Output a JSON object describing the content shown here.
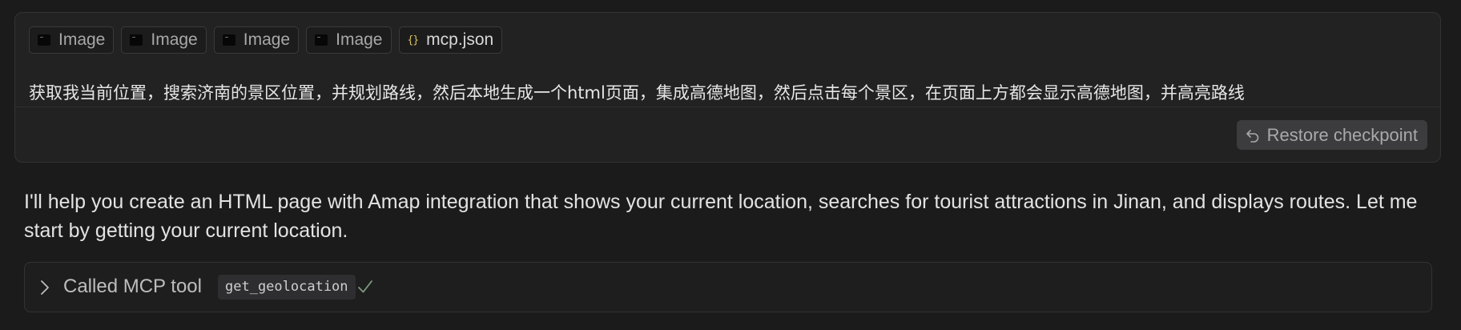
{
  "user_message": {
    "attachments": [
      {
        "label": "Image",
        "icon": "image-thumbnail-icon"
      },
      {
        "label": "Image",
        "icon": "image-thumbnail-icon"
      },
      {
        "label": "Image",
        "icon": "image-thumbnail-icon"
      },
      {
        "label": "Image",
        "icon": "image-thumbnail-icon"
      },
      {
        "label": "mcp.json",
        "icon": "json-braces-icon",
        "icon_glyph": "{}"
      }
    ],
    "text": "获取我当前位置，搜索济南的景区位置，并规划路线，然后本地生成一个html页面，集成高德地图，然后点击每个景区，在页面上方都会显示高德地图，并高亮路线",
    "restore_label": "Restore checkpoint"
  },
  "assistant_message": {
    "text": "I'll help you create an HTML page with Amap integration that shows your current location, searches for tourist attractions in Jinan, and displays routes. Let me start by getting your current location."
  },
  "tool_call": {
    "label": "Called MCP tool",
    "tool_name": "get_geolocation",
    "status": "success"
  },
  "colors": {
    "background": "#1b1b1c",
    "card": "#222223",
    "json_icon": "#d8c25c",
    "check": "#7f9a7f"
  }
}
